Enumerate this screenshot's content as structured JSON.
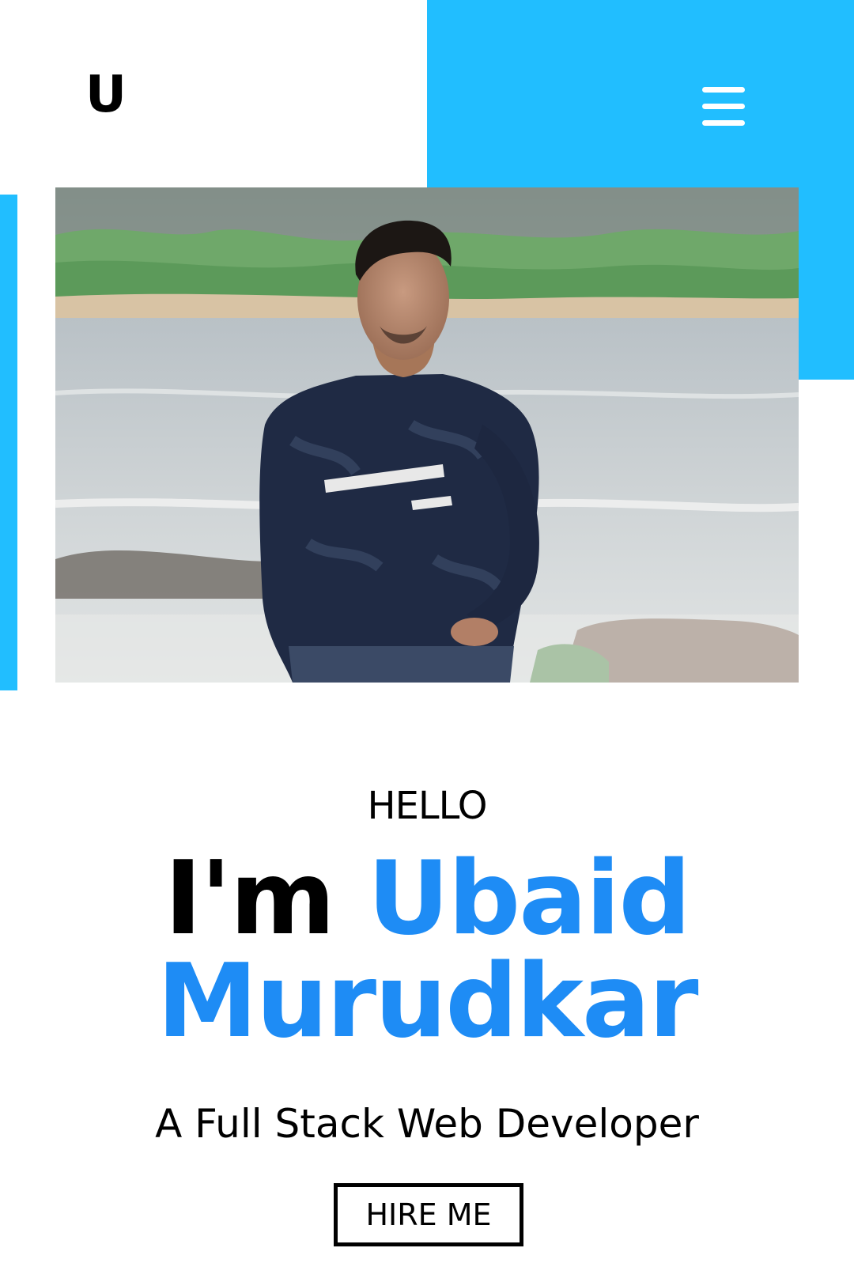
{
  "header": {
    "logo_text": "U",
    "menu_icon": "hamburger-menu-icon"
  },
  "hero": {
    "photo_alt": "Ubaid Murudkar",
    "greeting": "HELLO",
    "intro_prefix": "I'm",
    "name": "Ubaid Murudkar",
    "tagline": "A Full Stack Web Developer",
    "cta_label": "HIRE ME"
  },
  "colors": {
    "accent": "#21BEFF",
    "name_blue": "#1E8CF5",
    "text": "#000000",
    "background": "#FFFFFF"
  }
}
